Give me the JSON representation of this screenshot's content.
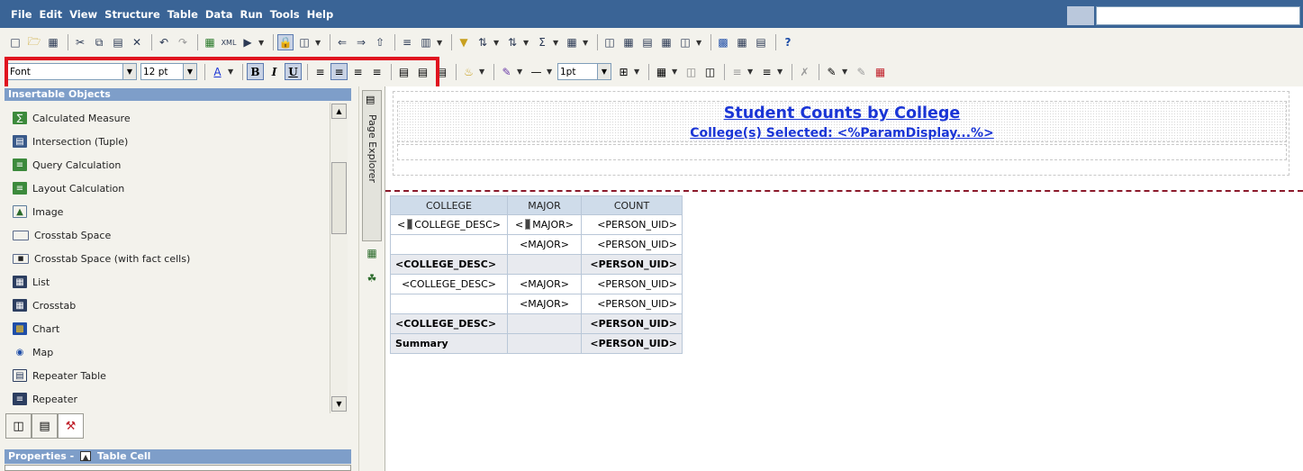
{
  "menubar": {
    "items": [
      "File",
      "Edit",
      "View",
      "Structure",
      "Table",
      "Data",
      "Run",
      "Tools",
      "Help"
    ]
  },
  "style_toolbar": {
    "font_value": "Font",
    "size_value": "12 pt",
    "border_width_value": "1pt"
  },
  "insertable_objects": {
    "title": "Insertable Objects",
    "items": [
      {
        "label": "Calculated Measure",
        "icon": "calculated-measure-icon"
      },
      {
        "label": "Intersection (Tuple)",
        "icon": "intersection-icon"
      },
      {
        "label": "Query Calculation",
        "icon": "query-calculation-icon"
      },
      {
        "label": "Layout Calculation",
        "icon": "layout-calculation-icon"
      },
      {
        "label": "Image",
        "icon": "image-icon"
      },
      {
        "label": "Crosstab Space",
        "icon": "crosstab-space-icon"
      },
      {
        "label": "Crosstab Space (with fact cells)",
        "icon": "crosstab-space-fact-icon"
      },
      {
        "label": "List",
        "icon": "list-icon"
      },
      {
        "label": "Crosstab",
        "icon": "crosstab-icon"
      },
      {
        "label": "Chart",
        "icon": "chart-icon"
      },
      {
        "label": "Map",
        "icon": "map-icon"
      },
      {
        "label": "Repeater Table",
        "icon": "repeater-table-icon"
      },
      {
        "label": "Repeater",
        "icon": "repeater-icon"
      }
    ]
  },
  "properties": {
    "title": "Properties -",
    "object": "Table Cell"
  },
  "page_explorer": {
    "label": "Page Explorer"
  },
  "report": {
    "title": "Student Counts by College",
    "subtitle": "College(s) Selected:   <%ParamDisplay...%>"
  },
  "crosstab": {
    "headers": [
      "COLLEGE",
      "MAJOR",
      "COUNT"
    ],
    "rows": [
      {
        "college": "COLLEGE_DESC>",
        "major": "MAJOR>",
        "count": "<PERSON_UID>",
        "type": "detail-first"
      },
      {
        "college": "",
        "major": "<MAJOR>",
        "count": "<PERSON_UID>",
        "type": "detail"
      },
      {
        "college": "<COLLEGE_DESC>",
        "major": "",
        "count": "<PERSON_UID>",
        "type": "total"
      },
      {
        "college": "<COLLEGE_DESC>",
        "major": "<MAJOR>",
        "count": "<PERSON_UID>",
        "type": "detail"
      },
      {
        "college": "",
        "major": "<MAJOR>",
        "count": "<PERSON_UID>",
        "type": "detail"
      },
      {
        "college": "<COLLEGE_DESC>",
        "major": "",
        "count": "<PERSON_UID>",
        "type": "total"
      },
      {
        "college": "Summary",
        "major": "",
        "count": "<PERSON_UID>",
        "type": "total"
      }
    ]
  },
  "colors": {
    "menubar": "#3a6496",
    "highlight": "#e0131f",
    "title_blue": "#1a35d6",
    "page_break": "#8b1a2b"
  }
}
